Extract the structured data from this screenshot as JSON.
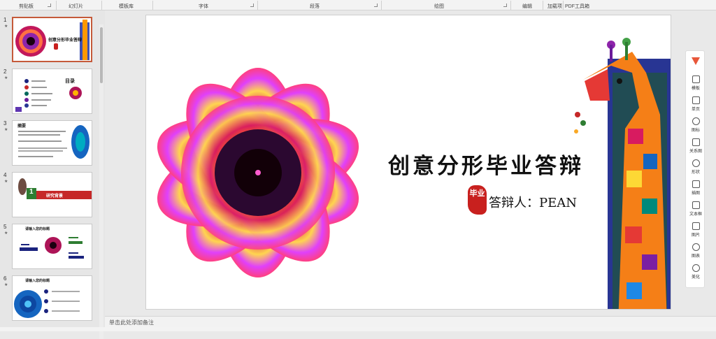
{
  "ribbon": {
    "groups": [
      "剪贴板",
      "幻灯片",
      "模板库",
      "字体",
      "段落",
      "绘图",
      "编辑",
      "加载项",
      "PDF工具箱"
    ]
  },
  "slides": [
    {
      "number": "1",
      "star": "★"
    },
    {
      "number": "2",
      "star": "★"
    },
    {
      "number": "3",
      "star": "★"
    },
    {
      "number": "4",
      "star": "★"
    },
    {
      "number": "5",
      "star": "★"
    },
    {
      "number": "6",
      "star": "★"
    }
  ],
  "thumbnails": {
    "t1_title": "创意分形毕业答辩",
    "t2_title": "目录",
    "t3_title": "摘要",
    "t4_chapter": "1",
    "t4_label": "研究背景",
    "t5_title": "请输入您的标题",
    "t6_title": "请输入您的标题"
  },
  "slide": {
    "title": "创意分形毕业答辩",
    "seal_text": "毕业",
    "presenter": "答辩人：PEAN"
  },
  "side_tools": [
    "模板",
    "单页",
    "图标",
    "关系图",
    "形状",
    "插图",
    "文本框",
    "图片",
    "图表",
    "美化"
  ],
  "notes_placeholder": "单击此处添加备注",
  "colors": {
    "selected_border": "#c55a3a",
    "seal_red": "#c8201e"
  }
}
